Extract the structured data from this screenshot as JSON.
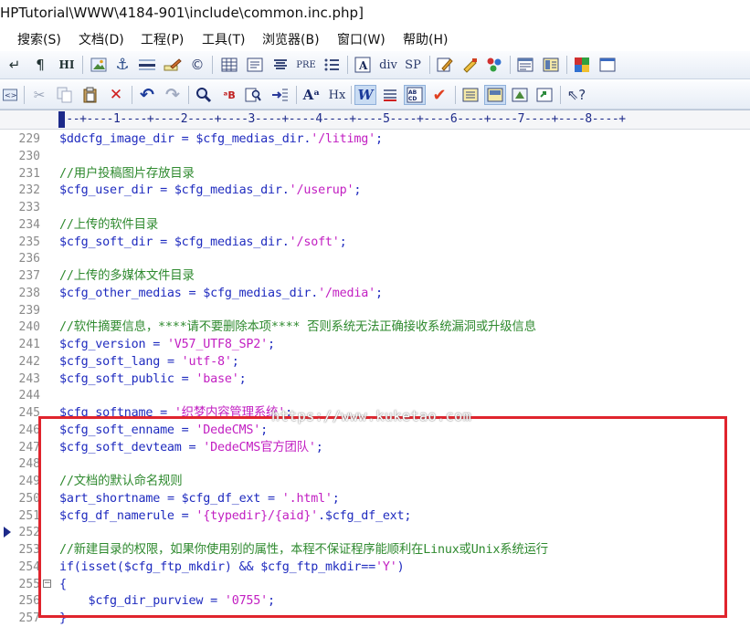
{
  "window": {
    "title": "HPTutorial\\WWW\\4184-901\\include\\common.inc.php]"
  },
  "menu": {
    "items": [
      {
        "label": "搜索(S)"
      },
      {
        "label": "文档(D)"
      },
      {
        "label": "工程(P)"
      },
      {
        "label": "工具(T)"
      },
      {
        "label": "浏览器(B)"
      },
      {
        "label": "窗口(W)"
      },
      {
        "label": "帮助(H)"
      }
    ]
  },
  "toolbar1": {
    "div_label": "div",
    "sp_label": "SP",
    "pre_label": "PRE",
    "hi_label": "HI"
  },
  "toolbar2": {
    "hx_label": "Hx"
  },
  "ruler": {
    "text": "---+----1----+----2----+----3----+----4----+----5----+----6----+----7----+----8----+"
  },
  "editor": {
    "lines": [
      {
        "num": "229",
        "code": [
          {
            "t": "var",
            "s": "$ddcfg_image_dir"
          },
          {
            "t": "op",
            "s": " = "
          },
          {
            "t": "var",
            "s": "$cfg_medias_dir"
          },
          {
            "t": "op",
            "s": "."
          },
          {
            "t": "str",
            "s": "'/litimg'"
          },
          {
            "t": "op",
            "s": ";"
          }
        ]
      },
      {
        "num": "230",
        "code": []
      },
      {
        "num": "231",
        "code": [
          {
            "t": "cm",
            "s": "//用户投稿图片存放目录"
          }
        ]
      },
      {
        "num": "232",
        "code": [
          {
            "t": "var",
            "s": "$cfg_user_dir"
          },
          {
            "t": "op",
            "s": " = "
          },
          {
            "t": "var",
            "s": "$cfg_medias_dir"
          },
          {
            "t": "op",
            "s": "."
          },
          {
            "t": "str",
            "s": "'/userup'"
          },
          {
            "t": "op",
            "s": ";"
          }
        ]
      },
      {
        "num": "233",
        "code": []
      },
      {
        "num": "234",
        "code": [
          {
            "t": "cm",
            "s": "//上传的软件目录"
          }
        ]
      },
      {
        "num": "235",
        "code": [
          {
            "t": "var",
            "s": "$cfg_soft_dir"
          },
          {
            "t": "op",
            "s": " = "
          },
          {
            "t": "var",
            "s": "$cfg_medias_dir"
          },
          {
            "t": "op",
            "s": "."
          },
          {
            "t": "str",
            "s": "'/soft'"
          },
          {
            "t": "op",
            "s": ";"
          }
        ]
      },
      {
        "num": "236",
        "code": []
      },
      {
        "num": "237",
        "code": [
          {
            "t": "cm",
            "s": "//上传的多媒体文件目录"
          }
        ]
      },
      {
        "num": "238",
        "code": [
          {
            "t": "var",
            "s": "$cfg_other_medias"
          },
          {
            "t": "op",
            "s": " = "
          },
          {
            "t": "var",
            "s": "$cfg_medias_dir"
          },
          {
            "t": "op",
            "s": "."
          },
          {
            "t": "str",
            "s": "'/media'"
          },
          {
            "t": "op",
            "s": ";"
          }
        ]
      },
      {
        "num": "239",
        "code": []
      },
      {
        "num": "240",
        "code": [
          {
            "t": "cm",
            "s": "//软件摘要信息，****请不要删除本项**** 否则系统无法正确接收系统漏洞或升级信息"
          }
        ]
      },
      {
        "num": "241",
        "code": [
          {
            "t": "var",
            "s": "$cfg_version"
          },
          {
            "t": "op",
            "s": " = "
          },
          {
            "t": "str",
            "s": "'V57_UTF8_SP2'"
          },
          {
            "t": "op",
            "s": ";"
          }
        ]
      },
      {
        "num": "242",
        "code": [
          {
            "t": "var",
            "s": "$cfg_soft_lang"
          },
          {
            "t": "op",
            "s": " = "
          },
          {
            "t": "str",
            "s": "'utf-8'"
          },
          {
            "t": "op",
            "s": ";"
          }
        ]
      },
      {
        "num": "243",
        "code": [
          {
            "t": "var",
            "s": "$cfg_soft_public"
          },
          {
            "t": "op",
            "s": " = "
          },
          {
            "t": "str",
            "s": "'base'"
          },
          {
            "t": "op",
            "s": ";"
          }
        ]
      },
      {
        "num": "244",
        "code": []
      },
      {
        "num": "245",
        "code": [
          {
            "t": "var",
            "s": "$cfg_softname"
          },
          {
            "t": "op",
            "s": " = "
          },
          {
            "t": "str",
            "s": "'织梦内容管理系统'"
          },
          {
            "t": "op",
            "s": ";"
          }
        ]
      },
      {
        "num": "246",
        "code": [
          {
            "t": "var",
            "s": "$cfg_soft_enname"
          },
          {
            "t": "op",
            "s": " = "
          },
          {
            "t": "str",
            "s": "'DedeCMS'"
          },
          {
            "t": "op",
            "s": ";"
          }
        ]
      },
      {
        "num": "247",
        "code": [
          {
            "t": "var",
            "s": "$cfg_soft_devteam"
          },
          {
            "t": "op",
            "s": " = "
          },
          {
            "t": "str",
            "s": "'DedeCMS官方团队'"
          },
          {
            "t": "op",
            "s": ";"
          }
        ]
      },
      {
        "num": "248",
        "code": []
      },
      {
        "num": "249",
        "code": [
          {
            "t": "cm",
            "s": "//文档的默认命名规则"
          }
        ]
      },
      {
        "num": "250",
        "code": [
          {
            "t": "var",
            "s": "$art_shortname"
          },
          {
            "t": "op",
            "s": " = "
          },
          {
            "t": "var",
            "s": "$cfg_df_ext"
          },
          {
            "t": "op",
            "s": " = "
          },
          {
            "t": "str",
            "s": "'.html'"
          },
          {
            "t": "op",
            "s": ";"
          }
        ]
      },
      {
        "num": "251",
        "code": [
          {
            "t": "var",
            "s": "$cfg_df_namerule"
          },
          {
            "t": "op",
            "s": " = "
          },
          {
            "t": "str",
            "s": "'{typedir}/{aid}'"
          },
          {
            "t": "op",
            "s": "."
          },
          {
            "t": "var",
            "s": "$cfg_df_ext"
          },
          {
            "t": "op",
            "s": ";"
          }
        ]
      },
      {
        "num": "252",
        "code": []
      },
      {
        "num": "253",
        "code": [
          {
            "t": "cm",
            "s": "//新建目录的权限，如果你使用别的属性，本程不保证程序能顺利在Linux或Unix系统运行"
          }
        ]
      },
      {
        "num": "254",
        "code": [
          {
            "t": "fn",
            "s": "if"
          },
          {
            "t": "op",
            "s": "("
          },
          {
            "t": "fn",
            "s": "isset"
          },
          {
            "t": "op",
            "s": "("
          },
          {
            "t": "var",
            "s": "$cfg_ftp_mkdir"
          },
          {
            "t": "op",
            "s": ") && "
          },
          {
            "t": "var",
            "s": "$cfg_ftp_mkdir"
          },
          {
            "t": "op",
            "s": "=="
          },
          {
            "t": "str",
            "s": "'Y'"
          },
          {
            "t": "op",
            "s": ")"
          }
        ]
      },
      {
        "num": "255",
        "code": [
          {
            "t": "op",
            "s": "{"
          }
        ]
      },
      {
        "num": "256",
        "code": [
          {
            "t": "op",
            "s": "    "
          },
          {
            "t": "var",
            "s": "$cfg_dir_purview"
          },
          {
            "t": "op",
            "s": " = "
          },
          {
            "t": "str",
            "s": "'0755'"
          },
          {
            "t": "op",
            "s": ";"
          }
        ]
      },
      {
        "num": "257",
        "code": [
          {
            "t": "op",
            "s": "}"
          }
        ]
      }
    ]
  },
  "watermark": {
    "text": "https://www.kuketao.com"
  },
  "colors": {
    "highlight_box": "#e0242d",
    "comment": "#2f8a2f",
    "string": "#c21fc2",
    "variable": "#1f2bbf"
  }
}
